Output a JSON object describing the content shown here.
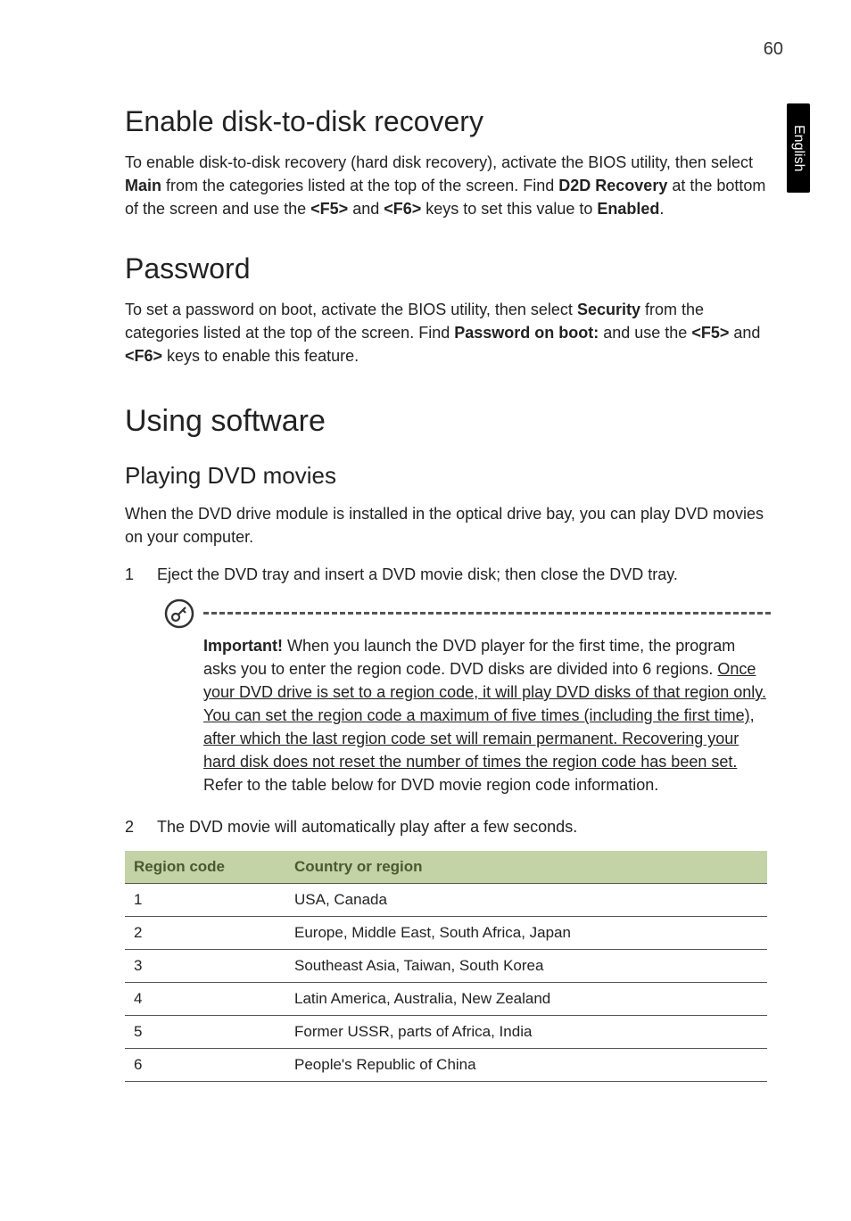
{
  "page_number": "60",
  "side_tab": "English",
  "sections": {
    "enable_recovery": {
      "heading": "Enable disk-to-disk recovery",
      "para_parts": [
        "To enable disk-to-disk recovery (hard disk recovery), activate the BIOS utility, then select ",
        "Main",
        " from the categories listed at the top of the screen. Find ",
        "D2D Recovery",
        " at the bottom of the screen and use the ",
        "<F5>",
        " and ",
        "<F6>",
        " keys to set this value to ",
        "Enabled",
        "."
      ]
    },
    "password": {
      "heading": "Password",
      "para_parts": [
        "To set a password on boot, activate the BIOS utility, then select ",
        "Security",
        " from the categories listed at the top of the screen. Find ",
        "Password on boot:",
        " and use the ",
        "<F5>",
        " and ",
        "<F6>",
        " keys to enable this feature."
      ]
    },
    "using_software": {
      "heading": "Using software",
      "sub_heading": "Playing DVD movies",
      "intro": "When the DVD drive module is installed in the optical drive bay, you can play DVD movies on your computer.",
      "step1_num": "1",
      "step1_text": "Eject the DVD tray and insert a DVD movie disk; then close the DVD tray.",
      "note": {
        "lead_bold": "Important!",
        "p1": " When you launch the DVD player for the first time, the program asks you to enter the region code. DVD disks are divided into 6 regions. ",
        "u1": "Once your DVD drive is set to a region code, it will play DVD disks of that region only. You can set the region code a maximum of five times (including the first time), after which the last region code set will remain permanent. Recovering your hard disk does not reset the number of times the region code has been set.",
        "p2": " Refer to the table below for DVD movie region code information."
      },
      "step2_num": "2",
      "step2_text": "The DVD movie will automatically play after a few seconds."
    }
  },
  "table": {
    "headers": [
      "Region code",
      "Country or region"
    ],
    "rows": [
      [
        "1",
        "USA, Canada"
      ],
      [
        "2",
        "Europe, Middle East, South Africa, Japan"
      ],
      [
        "3",
        "Southeast Asia, Taiwan, South Korea"
      ],
      [
        "4",
        "Latin America, Australia, New Zealand"
      ],
      [
        "5",
        "Former USSR, parts of Africa, India"
      ],
      [
        "6",
        "People's Republic of China"
      ]
    ]
  }
}
